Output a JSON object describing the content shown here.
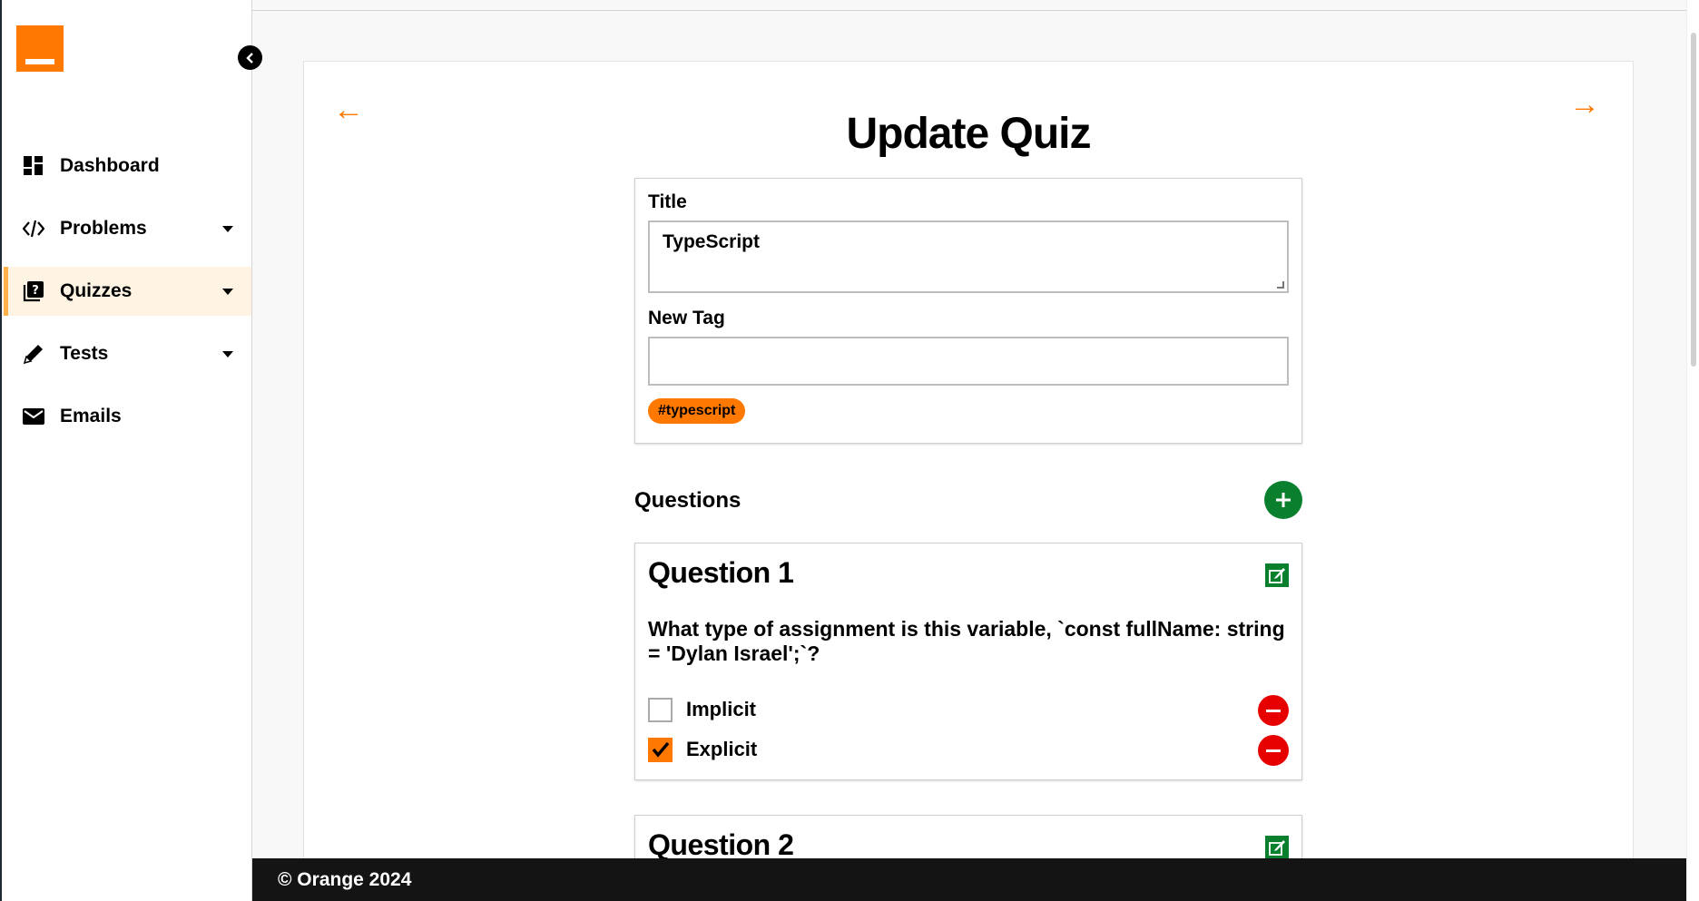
{
  "brand": {
    "accent": "#ff7900",
    "name": "Orange"
  },
  "sidebar": {
    "items": [
      {
        "label": "Dashboard",
        "icon": "dashboard-icon",
        "has_submenu": false,
        "active": false
      },
      {
        "label": "Problems",
        "icon": "code-icon",
        "has_submenu": true,
        "active": false
      },
      {
        "label": "Quizzes",
        "icon": "quiz-icon",
        "has_submenu": true,
        "active": true
      },
      {
        "label": "Tests",
        "icon": "pencil-icon",
        "has_submenu": true,
        "active": false
      },
      {
        "label": "Emails",
        "icon": "mail-icon",
        "has_submenu": false,
        "active": false
      }
    ]
  },
  "page": {
    "title": "Update Quiz",
    "back_icon": "arrow-left-icon",
    "forward_icon": "arrow-right-icon"
  },
  "form": {
    "title_label": "Title",
    "title_value": "TypeScript",
    "new_tag_label": "New Tag",
    "new_tag_value": "",
    "tags": [
      "#typescript"
    ]
  },
  "questions": {
    "heading": "Questions",
    "items": [
      {
        "title": "Question 1",
        "text": "What type of assignment is this variable, `const fullName: string = 'Dylan Israel';`?",
        "answers": [
          {
            "label": "Implicit",
            "checked": false
          },
          {
            "label": "Explicit",
            "checked": true
          }
        ]
      },
      {
        "title": "Question 2"
      }
    ]
  },
  "footer": {
    "text": "© Orange 2024"
  },
  "colors": {
    "add": "#0a7f2e",
    "remove": "#e60000",
    "edit": "#0a7f2e",
    "footer": "#141414"
  }
}
